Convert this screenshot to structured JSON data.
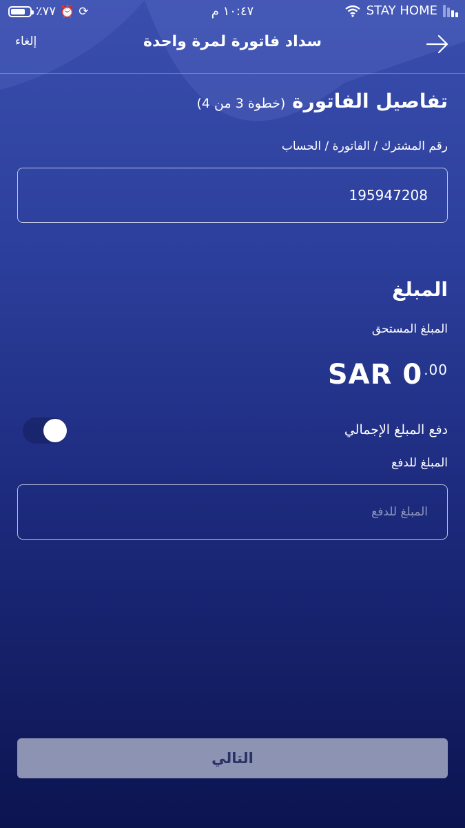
{
  "status_bar": {
    "battery_percent_text": "٪٧٧",
    "battery_level": 0.77,
    "alarm_icon": "alarm-clock-icon",
    "rotation_lock_icon": "rotation-lock-icon",
    "time": "١٠:٤٧ م",
    "carrier": "STAY HOME",
    "wifi_icon": "wifi-icon",
    "signal_icon": "signal-bars-icon"
  },
  "nav": {
    "cancel_label": "إلغاء",
    "title": "سداد فاتورة لمرة واحدة",
    "back_icon": "arrow-right-icon"
  },
  "bill_details": {
    "title": "تفاصيل الفاتورة",
    "step_note": "(خطوة 3 من 4)",
    "account_label": "رقم المشترك / الفاتورة / الحساب",
    "account_value": "195947208"
  },
  "amount_section": {
    "title": "المبلغ",
    "due_label": "المبلغ المستحق",
    "due_amount_main": "SAR 0",
    "due_amount_decimal": ".00",
    "pay_total_label": "دفع المبلغ الإجمالي",
    "pay_total_toggle_on": true,
    "pay_amount_label": "المبلغ للدفع",
    "pay_amount_placeholder": "المبلغ للدفع"
  },
  "footer": {
    "next_label": "التالي"
  },
  "colors": {
    "background_top": "#3a4eae",
    "background_bottom": "#0c1450",
    "button_bg": "#8d93b2",
    "button_text": "#2a3164"
  }
}
